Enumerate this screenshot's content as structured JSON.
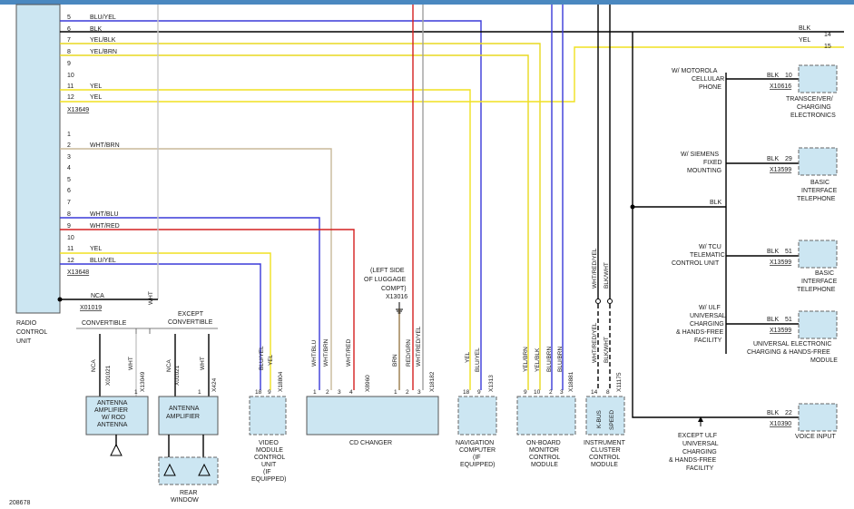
{
  "colors": {
    "radio_box": "#cce6f2",
    "top_bar": "#4a88c0",
    "wire_blue": "#3a3ad8",
    "wire_yellow": "#f0e020",
    "wire_red": "#d42020",
    "wire_brown": "#9a7b4a",
    "wire_gray": "#a0a0a0",
    "wire_black": "#000000",
    "wire_tan": "#c8b89a"
  },
  "radio_unit": {
    "name_line1": "RADIO",
    "name_line2": "CONTROL",
    "name_line3": "UNIT",
    "connector_upper": "X13649",
    "connector_lower": "X13648",
    "nca_label": "NCA",
    "nca_connector": "X01019"
  },
  "upper_pins": [
    {
      "pin": "5",
      "wire": "BLU/YEL"
    },
    {
      "pin": "6",
      "wire": "BLK"
    },
    {
      "pin": "7",
      "wire": "YEL/BLK"
    },
    {
      "pin": "8",
      "wire": "YEL/BRN"
    },
    {
      "pin": "10",
      "wire": ""
    },
    {
      "pin": "11",
      "wire": "YEL"
    },
    {
      "pin": "12",
      "wire": "YEL"
    }
  ],
  "lower_pins": [
    {
      "pin": "1",
      "wire": ""
    },
    {
      "pin": "2",
      "wire": "WHT/BRN"
    },
    {
      "pin": "3",
      "wire": ""
    },
    {
      "pin": "4",
      "wire": ""
    },
    {
      "pin": "5",
      "wire": ""
    },
    {
      "pin": "6",
      "wire": ""
    },
    {
      "pin": "7",
      "wire": ""
    },
    {
      "pin": "8",
      "wire": "WHT/BLU"
    },
    {
      "pin": "9",
      "wire": "WHT/RED"
    },
    {
      "pin": "10",
      "wire": ""
    },
    {
      "pin": "11",
      "wire": "YEL"
    },
    {
      "pin": "12",
      "wire": "BLU/YEL"
    }
  ],
  "off_page": [
    {
      "wire": "BLK",
      "ref": "14"
    },
    {
      "wire": "YEL",
      "ref": "15"
    }
  ],
  "wht_label": "WHT",
  "antenna": {
    "convertible": "CONVERTIBLE",
    "except_l1": "EXCEPT",
    "except_l2": "CONVERTIBLE",
    "left_wires": {
      "nca": "NCA",
      "conn": "X01021",
      "wht": "WHT",
      "pins": [
        "1",
        "X13049"
      ]
    },
    "right_wires": {
      "nca": "NCA",
      "conn": "X01021",
      "wht": "WHT",
      "pins": [
        "1",
        "X424"
      ]
    },
    "left_box": [
      "ANTENNA",
      "AMPLIFIER",
      "W/ ROD",
      "ANTENNA"
    ],
    "right_box": [
      "ANTENNA",
      "AMPLIFIER"
    ],
    "rear_l1": "REAR",
    "rear_l2": "WINDOW"
  },
  "video": {
    "wires": [
      "BLU/YEL",
      "YEL"
    ],
    "pins": [
      "18",
      "9"
    ],
    "conn": "X18804",
    "label": [
      "VIDEO",
      "MODULE",
      "CONTROL",
      "UNIT",
      "(IF",
      "EQUIPPED)"
    ]
  },
  "cd": {
    "wires": [
      "WHT/BLU",
      "WHT/BRN",
      "WHT/RED"
    ],
    "pins": [
      "1",
      "2",
      "3",
      "4"
    ],
    "conn": "X8960",
    "right_wires": [
      "BRN",
      "RED/GRN",
      "WHT/RED/YEL"
    ],
    "right_pins": [
      "1",
      "2",
      "3"
    ],
    "right_conn": "X18182",
    "ground_l1": "(LEFT SIDE",
    "ground_l2": "OF LUGGAGE",
    "ground_l3": "COMPT)",
    "ground_conn": "X13016",
    "label": "CD CHANGER"
  },
  "nav": {
    "wires": [
      "YEL",
      "BLU/YEL"
    ],
    "pins": [
      "18",
      "9"
    ],
    "conn": "X1313",
    "label": [
      "NAVIGATION",
      "COMPUTER",
      "(IF",
      "EQUIPPED)"
    ]
  },
  "obm": {
    "wires": [
      "YEL/BRN",
      "YEL/BLK",
      "BLU/BRN",
      "BLU/BRN"
    ],
    "pins": [
      "9",
      "10",
      "2",
      "3"
    ],
    "conn": "X18881",
    "label": [
      "ON-BOARD",
      "MONITOR",
      "CONTROL",
      "MODULE"
    ]
  },
  "cluster": {
    "top_wires": [
      "WHT/RED/YEL",
      "BLK/WHT"
    ],
    "wires": [
      "WHT/RED/YEL",
      "BLK/WHT"
    ],
    "pins": [
      "14",
      "8"
    ],
    "conn": "X11175",
    "inner": [
      "K-BUS",
      "SPEED"
    ],
    "label": [
      "INSTRUMENT",
      "CLUSTER",
      "CONTROL",
      "MODULE"
    ]
  },
  "telephones": {
    "blk_label": "BLK",
    "items": [
      {
        "cond": [
          "W/ MOTOROLA",
          "CELLULAR",
          "PHONE"
        ],
        "wire": "BLK",
        "pin": "10",
        "conn": "X10616",
        "module": [
          "TRANSCEIVER/",
          "CHARGING",
          "ELECTRONICS"
        ]
      },
      {
        "cond": [
          "W/ SIEMENS",
          "FIXED",
          "MOUNTING"
        ],
        "wire": "BLK",
        "pin": "29",
        "conn": "X13599",
        "module": [
          "BASIC",
          "INTERFACE",
          "TELEPHONE"
        ]
      },
      {
        "cond": [
          "W/ TCU",
          "TELEMATIC",
          "CONTROL UNIT"
        ],
        "wire": "BLK",
        "pin": "51",
        "conn": "X13599",
        "module": [
          "BASIC",
          "INTERFACE",
          "TELEPHONE"
        ]
      },
      {
        "cond": [
          "W/ ULF",
          "UNIVERSAL",
          "CHARGING",
          "& HANDS-FREE",
          "FACILITY"
        ],
        "wire": "BLK",
        "pin": "51",
        "conn": "X13599",
        "module": [
          "UNIVERSAL ELECTRONIC",
          "CHARGING & HANDS-FREE",
          "MODULE"
        ]
      },
      {
        "cond": [],
        "wire": "BLK",
        "pin": "22",
        "conn": "X10390",
        "module": [
          "VOICE INPUT"
        ]
      }
    ],
    "except_note": [
      "EXCEPT ULF",
      "UNIVERSAL",
      "CHARGING",
      "& HANDS-FREE",
      "FACILITY"
    ]
  },
  "figure_id": "208678"
}
